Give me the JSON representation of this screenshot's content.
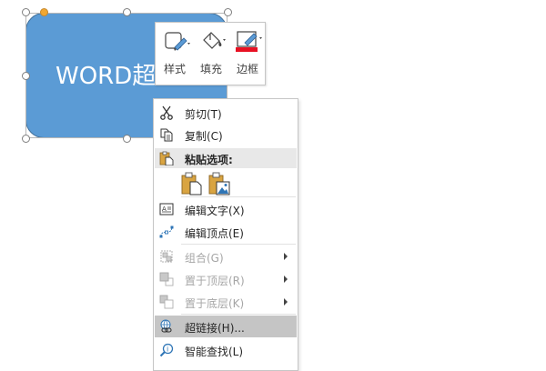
{
  "shape": {
    "text": "WORD超链接"
  },
  "mini_toolbar": {
    "buttons": [
      {
        "label": "样式",
        "icon": "shape-style-icon"
      },
      {
        "label": "填充",
        "icon": "paint-bucket-icon"
      },
      {
        "label": "边框",
        "icon": "pen-outline-icon",
        "accent_color": "#e81123"
      }
    ]
  },
  "context_menu": {
    "items": [
      {
        "label": "剪切(T)",
        "icon": "scissors-icon",
        "enabled": true
      },
      {
        "label": "复制(C)",
        "icon": "copy-icon",
        "enabled": true
      },
      {
        "label": "编辑文字(X)",
        "icon": "edit-text-icon",
        "enabled": true
      },
      {
        "label": "编辑顶点(E)",
        "icon": "edit-points-icon",
        "enabled": true
      },
      {
        "label": "组合(G)",
        "icon": "group-icon",
        "enabled": false,
        "submenu": true
      },
      {
        "label": "置于顶层(R)",
        "icon": "bring-to-front-icon",
        "enabled": false,
        "submenu": true
      },
      {
        "label": "置于底层(K)",
        "icon": "send-to-back-icon",
        "enabled": false,
        "submenu": true
      },
      {
        "label": "超链接(H)...",
        "icon": "hyperlink-icon",
        "enabled": true,
        "highlighted": true
      },
      {
        "label": "智能查找(L)",
        "icon": "smart-lookup-icon",
        "enabled": true
      }
    ],
    "paste_options": {
      "header": "粘贴选项:",
      "options": [
        "paste-keep-text-icon",
        "paste-picture-icon"
      ]
    }
  },
  "colors": {
    "shape_fill": "#5b9bd5",
    "menu_highlight": "#c5c5c5",
    "paste_header_bg": "#e8e8e8",
    "adjust_handle": "#f0a732"
  }
}
